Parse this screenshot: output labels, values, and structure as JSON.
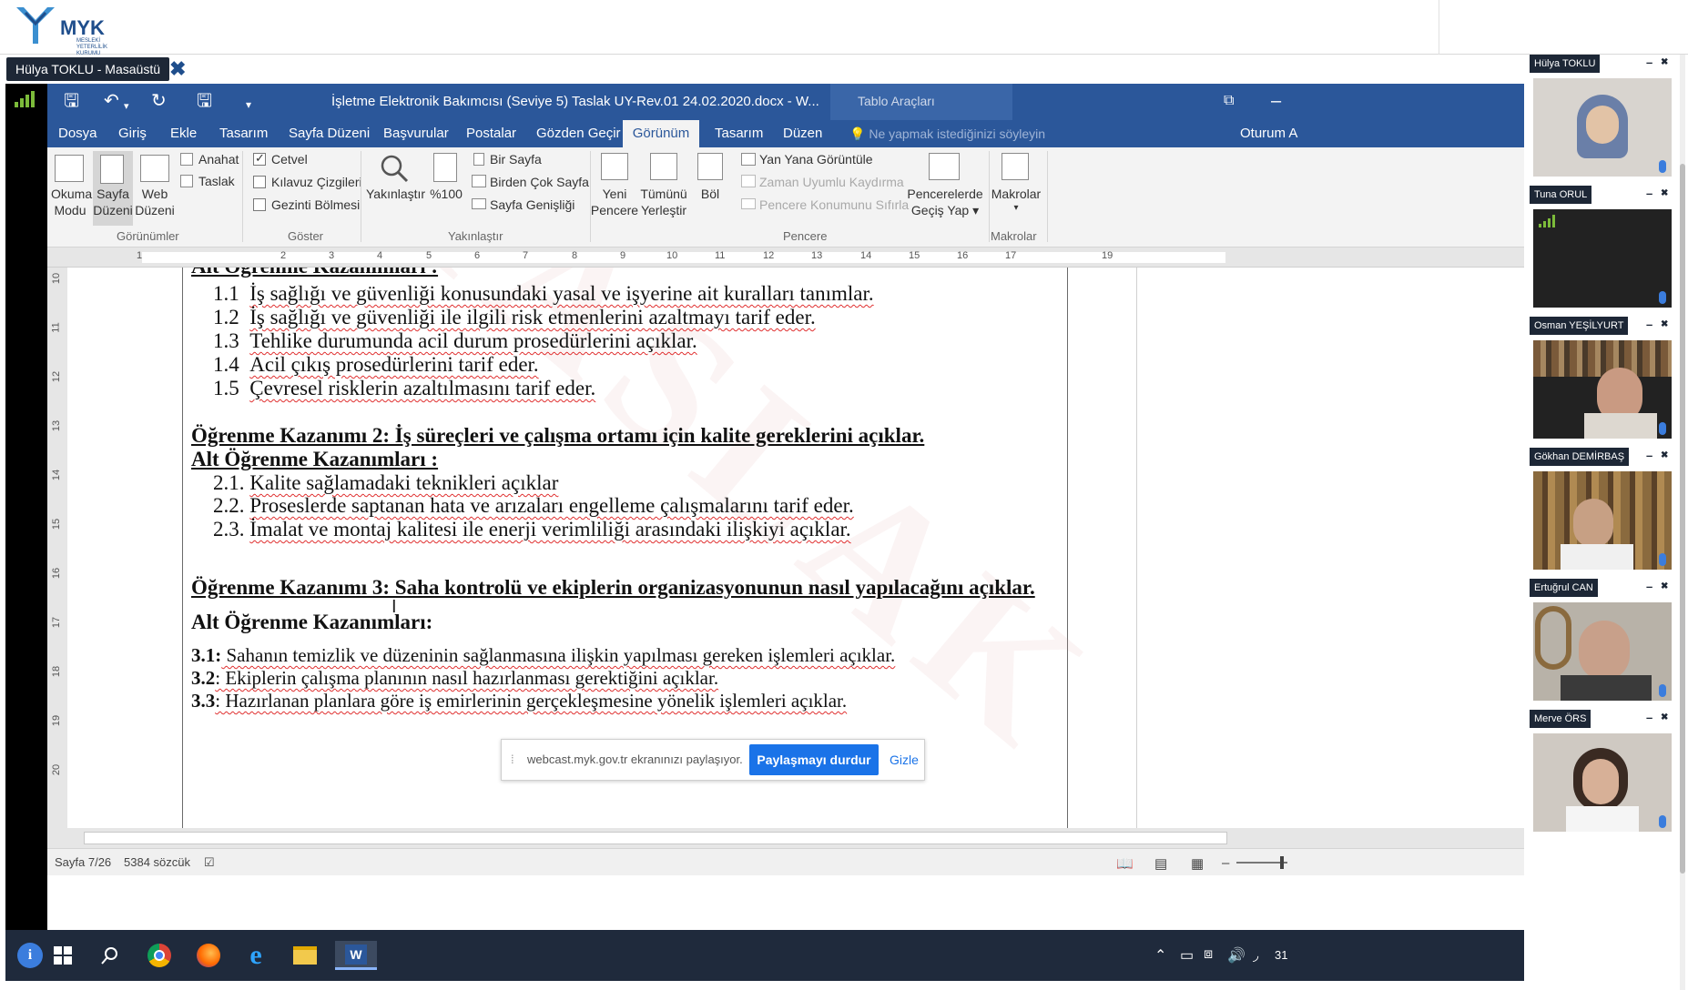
{
  "app": {
    "logo_text": "MYK",
    "logo_sub": "MESLEKİ YETERLİLİK KURUMU"
  },
  "share": {
    "presenter_label": "Hülya TOKLU - Masaüstü",
    "close_symbol": "✖",
    "notice_text": "webcast.myk.gov.tr ekranınızı paylaşıyor.",
    "stop_label": "Paylaşmayı durdur",
    "hide_label": "Gizle"
  },
  "word": {
    "doc_title": "İşletme Elektronik Bakımcısı (Seviye 5) Taslak UY-Rev.01 24.02.2020.docx - W...",
    "tools_title": "Tablo Araçları",
    "tabs": [
      {
        "label": "Dosya"
      },
      {
        "label": "Giriş"
      },
      {
        "label": "Ekle"
      },
      {
        "label": "Tasarım"
      },
      {
        "label": "Sayfa Düzeni"
      },
      {
        "label": "Başvurular"
      },
      {
        "label": "Postalar"
      },
      {
        "label": "Gözden Geçir"
      },
      {
        "label": "Görünüm"
      },
      {
        "label": "Tasarım"
      },
      {
        "label": "Düzen"
      }
    ],
    "tell_me": "Ne yapmak istediğinizi söyleyin",
    "signin": "Oturum A",
    "ribbon": {
      "okuma1": "Okuma",
      "okuma2": "Modu",
      "sayfa1": "Sayfa",
      "sayfa2": "Düzeni",
      "web1": "Web",
      "web2": "Düzeni",
      "anahat": "Anahat",
      "taslak": "Taslak",
      "cetvel": "Cetvel",
      "kilavuz": "Kılavuz Çizgileri",
      "gezinti": "Gezinti Bölmesi",
      "yakinlastir": "Yakınlaştır",
      "yuzde": "%100",
      "bir_sayfa": "Bir Sayfa",
      "birden_cok": "Birden Çok Sayfa",
      "sayfa_genisligi": "Sayfa Genişliği",
      "yeni1": "Yeni",
      "yeni2": "Pencere",
      "tumunu1": "Tümünü",
      "tumunu2": "Yerleştir",
      "bol": "Böl",
      "yan_yana": "Yan Yana Görüntüle",
      "zaman": "Zaman Uyumlu Kaydırma",
      "pencere_sifirla": "Pencere Konumunu Sıfırla",
      "pencereler1": "Pencerelerde",
      "pencereler2": "Geçiş Yap ▾",
      "makrolar1": "Makrolar",
      "makrolar2": "▾",
      "grp_gorunumler": "Görünümler",
      "grp_goster": "Göster",
      "grp_yakinlastir": "Yakınlaştır",
      "grp_pencere": "Pencere",
      "grp_makrolar": "Makrolar"
    },
    "ruler_numbers": [
      "1",
      "2",
      "3",
      "4",
      "5",
      "6",
      "7",
      "8",
      "9",
      "10",
      "11",
      "12",
      "13",
      "14",
      "15",
      "16",
      "17",
      "19"
    ],
    "vruler_numbers": [
      "10",
      "11",
      "12",
      "13",
      "14",
      "15",
      "16",
      "17",
      "18",
      "19",
      "20"
    ],
    "doc": {
      "top_heading": "Alt Öğrenme Kazanımları :",
      "items1": [
        {
          "num": "1.1",
          "text": "İş sağlığı ve güvenliği konusundaki yasal ve işyerine ait kuralları tanımlar."
        },
        {
          "num": "1.2",
          "text": "İş sağlığı ve güvenliği ile ilgili risk etmenlerini azaltmayı tarif eder."
        },
        {
          "num": "1.3",
          "text": "Tehlike durumunda acil durum prosedürlerini açıklar."
        },
        {
          "num": "1.4",
          "text": "Acil çıkış prosedürlerini tarif eder."
        },
        {
          "num": "1.5",
          "text": "Çevresel risklerin azaltılmasını tarif eder."
        }
      ],
      "heading2": "Öğrenme Kazanımı 2: İş süreçleri ve çalışma ortamı için kalite gereklerini açıklar.",
      "sub2": "Alt Öğrenme Kazanımları :",
      "items2": [
        {
          "num": "2.1.",
          "text": "Kalite sağlamadaki teknikleri açıklar"
        },
        {
          "num": "2.2.",
          "text": "Proseslerde saptanan hata ve arızaları engelleme çalışmalarını tarif eder."
        },
        {
          "num": "2.3.",
          "text": "İmalat ve montaj kalitesi ile enerji verimliliği arasındaki ilişkiyi açıklar."
        }
      ],
      "heading3": "Öğrenme Kazanımı 3: Saha kontrolü ve ekiplerin organizasyonunun nasıl yapılacağını açıklar.",
      "sub3": "Alt Öğrenme Kazanımları:",
      "items3": [
        {
          "num": "3.1:",
          "text": " Sahanın temizlik ve düzeninin sağlanmasına ilişkin yapılması gereken işlemleri açıklar."
        },
        {
          "num": "3.2",
          "text": ": Ekiplerin çalışma planının nasıl hazırlanması gerektiğini açıklar."
        },
        {
          "num": "3.3",
          "text": ": Hazırlanan planlara göre iş emirlerinin gerçekleşmesine yönelik işlemleri açıklar."
        }
      ]
    },
    "status": {
      "page": "Sayfa 7/26",
      "words": "5384 sözcük"
    }
  },
  "taskbar": {
    "clock": "31"
  },
  "participants": [
    {
      "name": "Hülya TOKLU",
      "video_bg": "#d8d4cf"
    },
    {
      "name": "Tuna ORUL",
      "video_bg": "#000000"
    },
    {
      "name": "Osman YEŞİLYURT",
      "video_bg": "#6b5846"
    },
    {
      "name": "Gökhan DEMİRBAŞ",
      "video_bg": "#8a6a3e"
    },
    {
      "name": "Ertuğrul CAN",
      "video_bg": "#b8b2a8"
    },
    {
      "name": "Merve ÖRS",
      "video_bg": "#cfc9c2"
    }
  ],
  "participant_controls": {
    "minimize": "–",
    "close": "✖"
  },
  "colors": {
    "word_blue": "#2b579a",
    "share_blue": "#1a73e8",
    "dark_label": "#1d2736",
    "signal_green": "#7cbb3a"
  }
}
